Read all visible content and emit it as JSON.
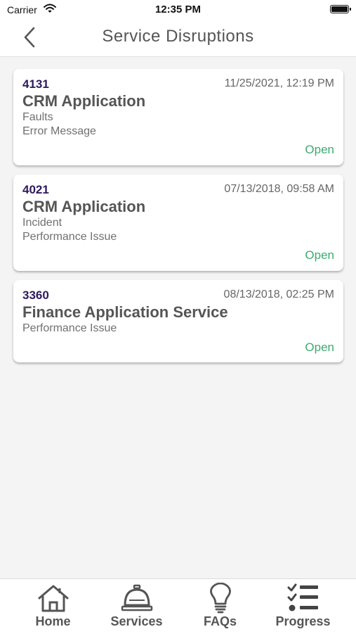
{
  "status_bar": {
    "carrier": "Carrier",
    "time": "12:35 PM"
  },
  "header": {
    "title": "Service Disruptions",
    "back_icon": "chevron-left-icon"
  },
  "disruptions": [
    {
      "id": "4131",
      "date": "11/25/2021, 12:19 PM",
      "title": "CRM Application",
      "category": "Faults",
      "type": "Error Message",
      "status": "Open"
    },
    {
      "id": "4021",
      "date": "07/13/2018, 09:58 AM",
      "title": "CRM Application",
      "category": "Incident",
      "type": "Performance Issue",
      "status": "Open"
    },
    {
      "id": "3360",
      "date": "08/13/2018, 02:25 PM",
      "title": "Finance Application Service",
      "category": "Performance Issue",
      "status": "Open"
    }
  ],
  "tabs": [
    {
      "label": "Home",
      "icon": "home-icon"
    },
    {
      "label": "Services",
      "icon": "service-bell-icon"
    },
    {
      "label": "FAQs",
      "icon": "lightbulb-icon"
    },
    {
      "label": "Progress",
      "icon": "checklist-icon"
    }
  ],
  "colors": {
    "id": "#2e1a5c",
    "status_open": "#3daa6e",
    "background": "#f4f4f4"
  }
}
